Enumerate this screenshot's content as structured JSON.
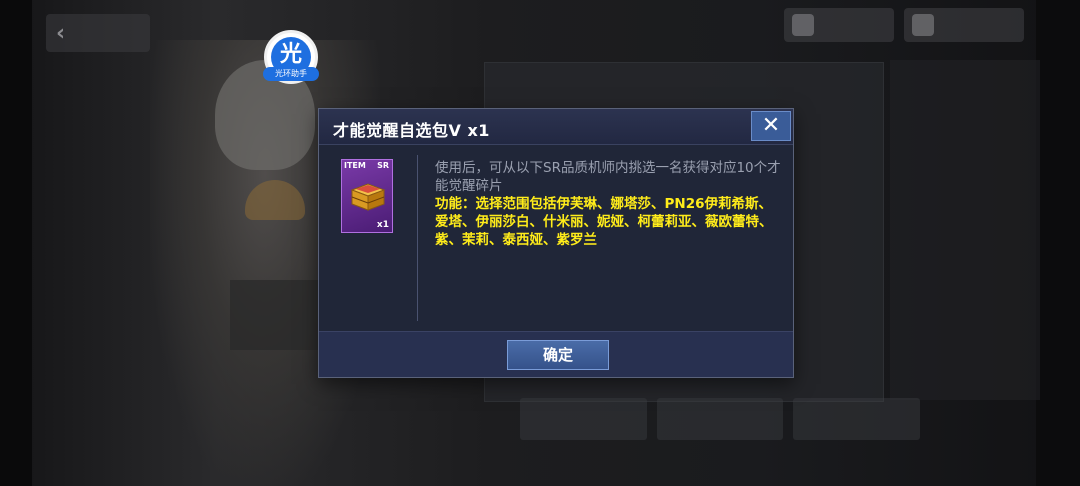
{
  "watermark": {
    "glyph": "光",
    "label": "光环助手"
  },
  "dialog": {
    "title": "才能觉醒自选包V x1",
    "close_glyph": "✕",
    "item": {
      "tag": "ITEM",
      "rarity": "SR",
      "quantity": "x1",
      "icon": "golden-chest-icon"
    },
    "description": "使用后，可从以下SR品质机师内挑选一名获得对应10个才能觉醒碎片",
    "function_text": "功能：选择范围包括伊芙琳、娜塔莎、PN26伊莉希斯、爱塔、伊丽莎白、什米丽、妮娅、柯蕾莉亚、薇欧蕾特、紫、茉莉、泰西娅、紫罗兰",
    "confirm_label": "确定"
  },
  "colors": {
    "dialog_bg": "#242a3e",
    "function_text": "#ffec1a",
    "button": "#3a5c98",
    "rarity_sr": "#7a3aa8"
  }
}
